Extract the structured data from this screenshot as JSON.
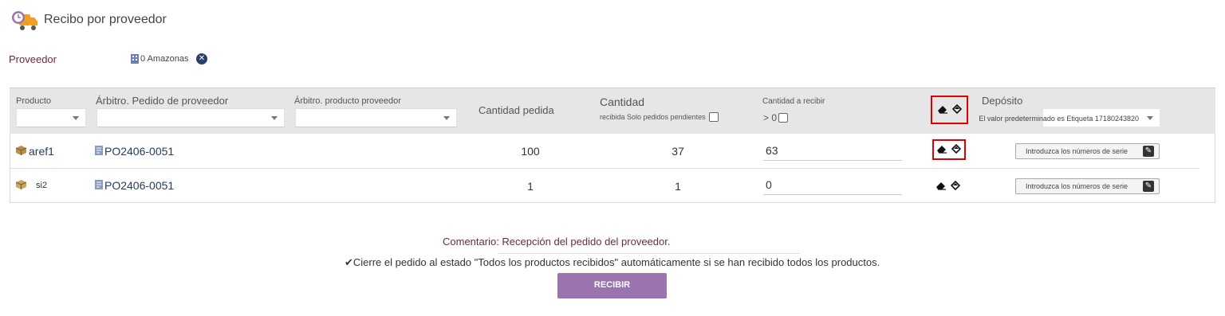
{
  "header": {
    "title": "Recibo por proveedor",
    "icon": "truck-clock-icon"
  },
  "provider": {
    "label": "Proveedor",
    "value": "0 Amazonas",
    "value_icon": "building-icon",
    "remove_icon": "close-icon"
  },
  "table": {
    "headers": {
      "product": "Producto",
      "order_ref": "Árbitro. Pedido de proveedor",
      "product_ref": "Árbitro. producto proveedor",
      "ordered_qty": "Cantidad pedida",
      "received_title": "Cantidad",
      "received_sub": "recibida Solo pedidos pendientes",
      "to_receive": "Cantidad a recibir",
      "to_receive_sub": "> 0",
      "warehouse": "Depósito",
      "warehouse_default": "El valor predeterminado es Etiqueta 17180243820"
    },
    "rows": [
      {
        "product": "aref1",
        "order": "PO2406-0051",
        "ordered": "100",
        "received": "37",
        "to_receive": "63",
        "serial_label": "Introduzca los números de serie"
      },
      {
        "product": "si2",
        "order": "PO2406-0051",
        "ordered": "1",
        "received": "1",
        "to_receive": "0",
        "serial_label": "Introduzca los números de serie"
      }
    ]
  },
  "footer": {
    "comment": "Comentario: Recepción del pedido del proveedor.",
    "autoclose": "✔Cierre el pedido al estado \"Todos los productos recibidos\" automáticamente si se han recibido todos los productos.",
    "receive_button": "RECIBIR"
  },
  "colors": {
    "accent": "#9b73ae",
    "highlight": "#e00000",
    "header_bg": "#e6e6e6"
  }
}
